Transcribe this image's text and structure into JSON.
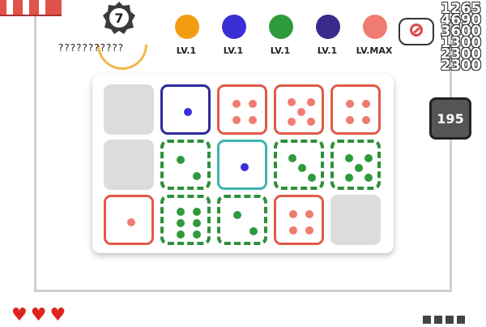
{
  "player": {
    "name": "???????????",
    "level": "7"
  },
  "deck": [
    {
      "icon": "fire-dice-icon",
      "color": "#f39c12",
      "level": "LV.1"
    },
    {
      "icon": "blue-dot-dice-icon",
      "color": "#3a2fd6",
      "level": "LV.1"
    },
    {
      "icon": "green-wind-dice-icon",
      "color": "#2e9a3c",
      "level": "LV.1"
    },
    {
      "icon": "purple-wind-dice-icon",
      "color": "#3b2a8a",
      "level": "LV.1"
    },
    {
      "icon": "red-dot-dice-icon",
      "color": "#f07b72",
      "level": "LV.MAX"
    }
  ],
  "sp_values": [
    "1265",
    "4690",
    "3600",
    "1300",
    "2300",
    "2300"
  ],
  "summon_cost": "195",
  "lives": [
    "heart-icon",
    "heart-icon",
    "heart-icon"
  ],
  "colors": {
    "accent_red": "#e05a4a",
    "board_empty": "#dcdcdc",
    "heart": "#e0231f"
  },
  "board": [
    {
      "type": "empty"
    },
    {
      "type": "blue",
      "pips": 1
    },
    {
      "type": "red",
      "pips": 4
    },
    {
      "type": "red",
      "pips": 5
    },
    {
      "type": "red",
      "pips": 4
    },
    {
      "type": "empty"
    },
    {
      "type": "green",
      "pips": 2
    },
    {
      "type": "teal",
      "pips": 1
    },
    {
      "type": "green",
      "pips": 3
    },
    {
      "type": "green",
      "pips": 5
    },
    {
      "type": "red",
      "pips": 1
    },
    {
      "type": "green",
      "pips": 6
    },
    {
      "type": "green",
      "pips": 2
    },
    {
      "type": "red",
      "pips": 4
    },
    {
      "type": "empty"
    }
  ]
}
